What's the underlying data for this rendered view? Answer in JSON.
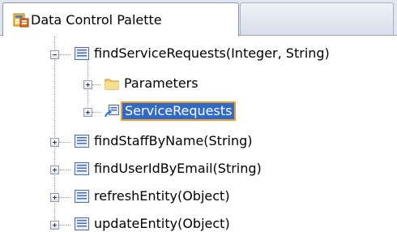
{
  "tabs": {
    "active_label": "Data Control Palette"
  },
  "tree": {
    "root": {
      "label": "findServiceRequests(Integer, String)",
      "expander": "minus",
      "icon": "method-icon",
      "children": [
        {
          "label": "Parameters",
          "icon": "folder-icon",
          "expander": "plus"
        },
        {
          "label": "ServiceRequests",
          "icon": "collection-icon",
          "expander": "plus",
          "selected": true
        }
      ]
    },
    "siblings": [
      {
        "label": "findStaffByName(String)",
        "icon": "method-icon",
        "expander": "plus"
      },
      {
        "label": "findUserIdByEmail(String)",
        "icon": "method-icon",
        "expander": "plus"
      },
      {
        "label": "refreshEntity(Object)",
        "icon": "method-icon",
        "expander": "plus"
      },
      {
        "label": "updateEntity(Object)",
        "icon": "method-icon",
        "expander": "plus"
      }
    ]
  },
  "colors": {
    "selection_bg": "#3169c6",
    "selection_outline": "#f0a030",
    "tab_strip_bg": "#dfe6f0"
  }
}
